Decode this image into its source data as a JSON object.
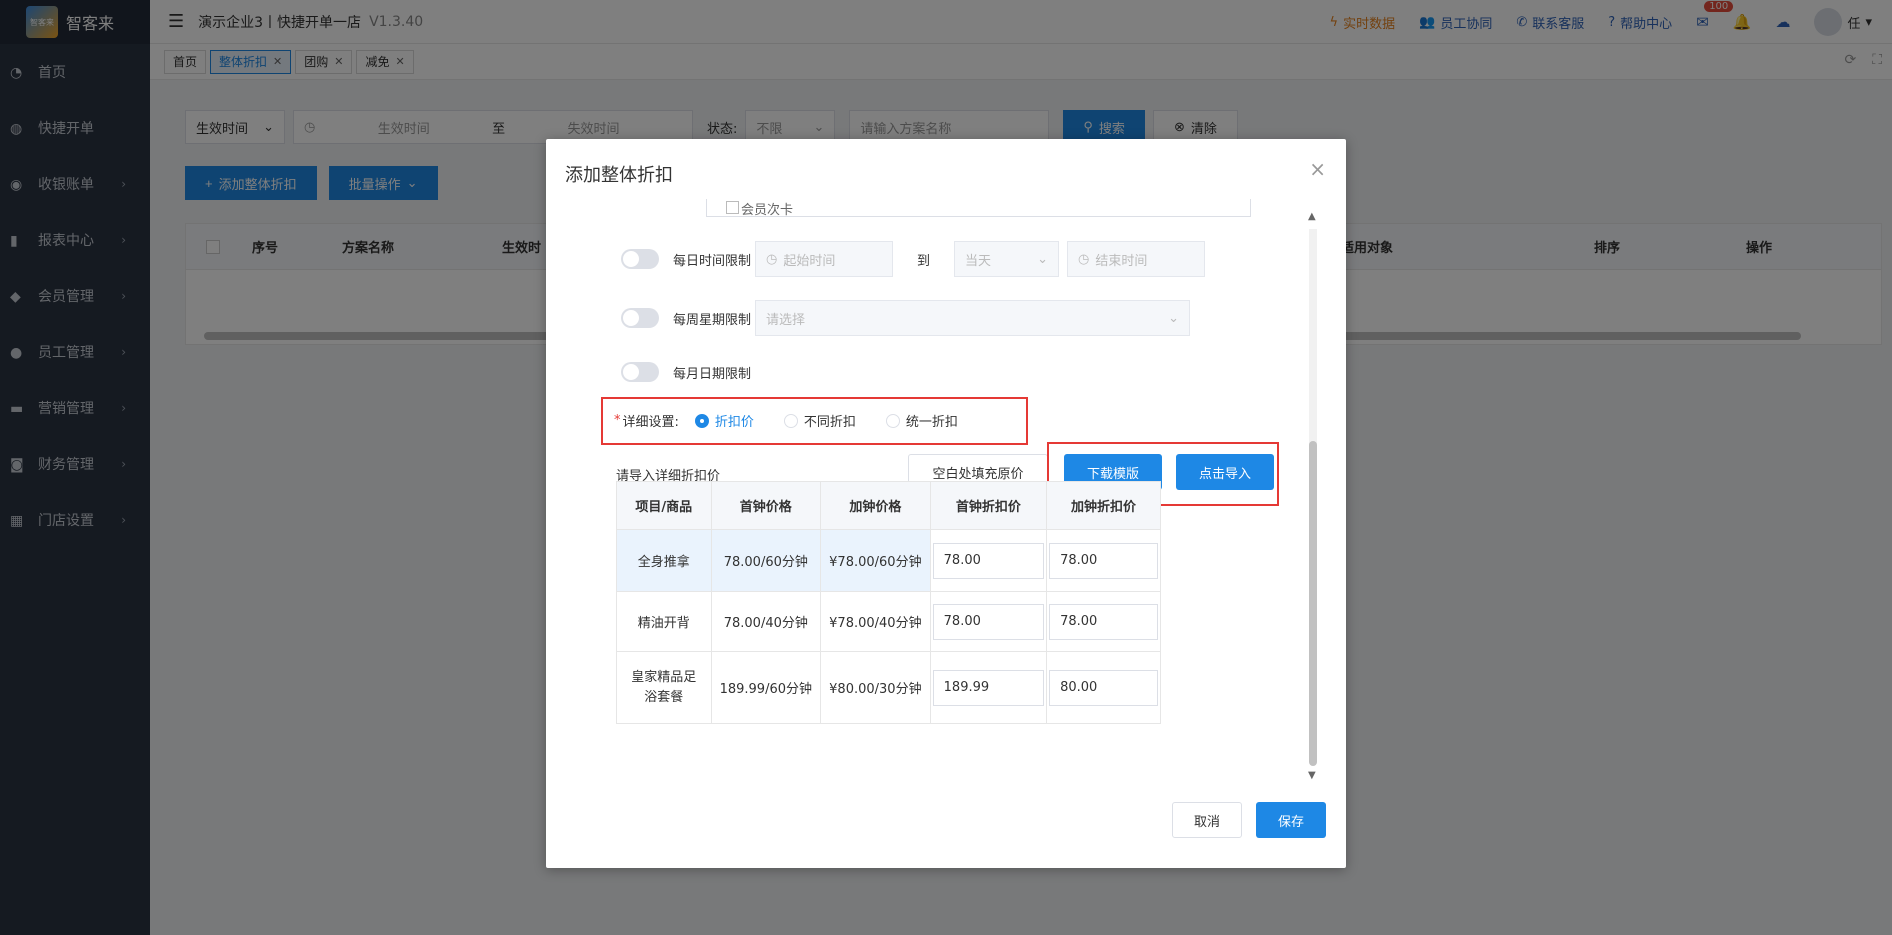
{
  "sidebar": {
    "logo_badge": "智客来",
    "logo_text": "智客来",
    "items": [
      {
        "label": "首页",
        "icon": "dashboard-icon",
        "chev": ""
      },
      {
        "label": "快捷开单",
        "icon": "bag-icon",
        "chev": ""
      },
      {
        "label": "收银账单",
        "icon": "money-bag-icon",
        "chev": "›"
      },
      {
        "label": "报表中心",
        "icon": "bar-chart-icon",
        "chev": "›"
      },
      {
        "label": "会员管理",
        "icon": "diamond-icon",
        "chev": "›"
      },
      {
        "label": "员工管理",
        "icon": "user-icon",
        "chev": "›"
      },
      {
        "label": "营销管理",
        "icon": "briefcase-icon",
        "chev": "›"
      },
      {
        "label": "财务管理",
        "icon": "wallet-icon",
        "chev": "›"
      },
      {
        "label": "门店设置",
        "icon": "grid-icon",
        "chev": "›"
      }
    ]
  },
  "topbar": {
    "title": "演示企业3丨快捷开单一店",
    "version": "V1.3.40",
    "realtime": "实时数据",
    "staff": "员工协同",
    "service": "联系客服",
    "help": "帮助中心",
    "mail_badge": "100",
    "user": "任"
  },
  "tabs": [
    {
      "label": "首页",
      "closable": false,
      "active": false
    },
    {
      "label": "整体折扣",
      "closable": true,
      "active": true
    },
    {
      "label": "团购",
      "closable": true,
      "active": false
    },
    {
      "label": "减免",
      "closable": true,
      "active": false
    }
  ],
  "filters": {
    "time_type": "生效时间",
    "start_placeholder": "生效时间",
    "to": "至",
    "end_placeholder": "失效时间",
    "status_label": "状态:",
    "status_value": "不限",
    "name_placeholder": "请输入方案名称",
    "search": "搜索",
    "clear": "清除"
  },
  "actions": {
    "add": "添加整体折扣",
    "batch": "批量操作"
  },
  "bg_table": {
    "headers": [
      "序号",
      "方案名称",
      "生效时",
      "适用对象",
      "排序",
      "操作"
    ]
  },
  "modal": {
    "title": "添加整体折扣",
    "cut_text": "会员次卡",
    "daily_limit": "每日时间限制",
    "start_time": "起始时间",
    "to": "到",
    "same_day": "当天",
    "end_time": "结束时间",
    "weekly_limit": "每周星期限制",
    "select_placeholder": "请选择",
    "monthly_limit": "每月日期限制",
    "detail_label": "详细设置:",
    "radio_options": [
      "折扣价",
      "不同折扣",
      "统一折扣"
    ],
    "import_hint": "请导入详细折扣价",
    "fill_original": "空白处填充原价",
    "download_template": "下载模版",
    "click_import": "点击导入",
    "table_headers": [
      "项目/商品",
      "首钟价格",
      "加钟价格",
      "首钟折扣价",
      "加钟折扣价"
    ],
    "rows": [
      {
        "name": "全身推拿",
        "first_price": "78.00/60分钟",
        "add_price": "¥78.00/60分钟",
        "first_discount": "78.00",
        "add_discount": "78.00"
      },
      {
        "name": "精油开背",
        "first_price": "78.00/40分钟",
        "add_price": "¥78.00/40分钟",
        "first_discount": "78.00",
        "add_discount": "78.00"
      },
      {
        "name": "皇家精品足浴套餐",
        "first_price": "189.99/60分钟",
        "add_price": "¥80.00/30分钟",
        "first_discount": "189.99",
        "add_discount": "80.00"
      }
    ],
    "cancel": "取消",
    "save": "保存"
  },
  "colors": {
    "primary": "#1e88e5",
    "sidebar_bg": "#2b3443",
    "highlight_red": "#e53935"
  }
}
